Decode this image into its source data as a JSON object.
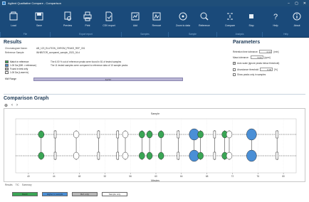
{
  "window": {
    "title": "Agilent Qualitative Compare - Comparison",
    "controls": [
      "−",
      "▢",
      "✕"
    ]
  },
  "ribbon": {
    "buttons": [
      {
        "label": "Load",
        "icon": "load-icon"
      },
      {
        "label": "Save",
        "icon": "save-icon"
      },
      {
        "label": "Preview",
        "icon": "preview-icon"
      },
      {
        "label": "Print",
        "icon": "print-icon"
      },
      {
        "label": "CSV export",
        "icon": "csv-export-icon"
      },
      {
        "label": "Add",
        "icon": "add-icon"
      },
      {
        "label": "Remove",
        "icon": "remove-icon"
      },
      {
        "label": "Zoom to data",
        "icon": "zoom-to-data-icon"
      },
      {
        "label": "Reference",
        "icon": "reference-icon"
      },
      {
        "label": "Compare",
        "icon": "compare-icon"
      },
      {
        "label": "Stop",
        "icon": "stop-icon"
      },
      {
        "label": "Help",
        "icon": "help-icon"
      },
      {
        "label": "About",
        "icon": "about-icon"
      }
    ],
    "groups": [
      "File",
      "Export report",
      "Samples",
      "Sample",
      "Analysis",
      "Help"
    ]
  },
  "results": {
    "title": "Results",
    "fields": [
      {
        "key": "Chromatogram Name:",
        "value": "AB_123_ELUTION_CHROM_PEAKS_REF_001"
      },
      {
        "key": "Reference Sample:",
        "value": "INHIBITOR_compared_sample_2023_04.d"
      }
    ],
    "legend": [
      {
        "label": "Match in reference",
        "color": "#3aa655"
      },
      {
        "label": "1.00 Da (Diff. > reference)",
        "color": "#4a8fd6"
      },
      {
        "label": "Found in test only",
        "color": "#b8b8b8"
      },
      {
        "label": "1.00 Da (Lower in)",
        "color": "#ffffff"
      }
    ],
    "description_lines": [
      "The 6.00 % out of reference peaks were found in 81 of tested samples",
      "The 11 tested samples were compared to reference data of 10 sample peaks"
    ],
    "mw_label": "MW Range",
    "mw_value": "61767"
  },
  "parameters": {
    "title": "Parameters",
    "rows": [
      {
        "label": "Retention time tolerance:",
        "value": "0.10",
        "unit": "[min]"
      },
      {
        "label": "Mass tolerance:",
        "value": "5.00",
        "unit": "[ppm]"
      },
      {
        "label": "Auto scale (ignore peaks below threshold)",
        "checked": true
      },
      {
        "label": "Abundance threshold",
        "value": "0.00",
        "unit": "[%]",
        "checked": false
      },
      {
        "label": "Show peaks only in samples",
        "checked": false
      }
    ]
  },
  "graph": {
    "title": "Comparison Graph",
    "tools": [
      "⊕",
      "‹",
      "›"
    ],
    "axis_title": "Sample",
    "x_label": "Minutes",
    "tabs": [
      "Results",
      "TIC",
      "Summary"
    ]
  },
  "bottom_legend": [
    {
      "label": "Match",
      "color": "#3aa655"
    },
    {
      "label": "Higher in sample",
      "color": "#4a8fd6"
    },
    {
      "label": "Ref. only",
      "color": "#b8b8b8"
    },
    {
      "label": "Sample only",
      "color": "#ffffff"
    }
  ],
  "chart_data": {
    "type": "scatter",
    "title": "",
    "xlabel": "Minutes",
    "ylabel": "",
    "xlim": [
      38,
      82
    ],
    "xticks": [
      40,
      44,
      48,
      52,
      56,
      60,
      64,
      68,
      72,
      76,
      80
    ],
    "rows": 2,
    "peaks": [
      {
        "x": 42.0,
        "type": "match"
      },
      {
        "x": 44.2,
        "type": "ref-only"
      },
      {
        "x": 47.5,
        "type": "sample-only"
      },
      {
        "x": 51.0,
        "type": "ref-only"
      },
      {
        "x": 54.0,
        "type": "ref-only"
      },
      {
        "x": 55.2,
        "type": "sample-only"
      },
      {
        "x": 57.8,
        "type": "match"
      },
      {
        "x": 59.0,
        "type": "match"
      },
      {
        "x": 60.8,
        "type": "match"
      },
      {
        "x": 63.5,
        "type": "ref-only"
      },
      {
        "x": 66.0,
        "type": "higher"
      },
      {
        "x": 67.0,
        "type": "match"
      },
      {
        "x": 69.2,
        "type": "ref-only"
      },
      {
        "x": 70.8,
        "type": "match"
      },
      {
        "x": 71.5,
        "type": "sample-only"
      },
      {
        "x": 75.0,
        "type": "higher"
      },
      {
        "x": 79.0,
        "type": "ref-only"
      }
    ]
  }
}
